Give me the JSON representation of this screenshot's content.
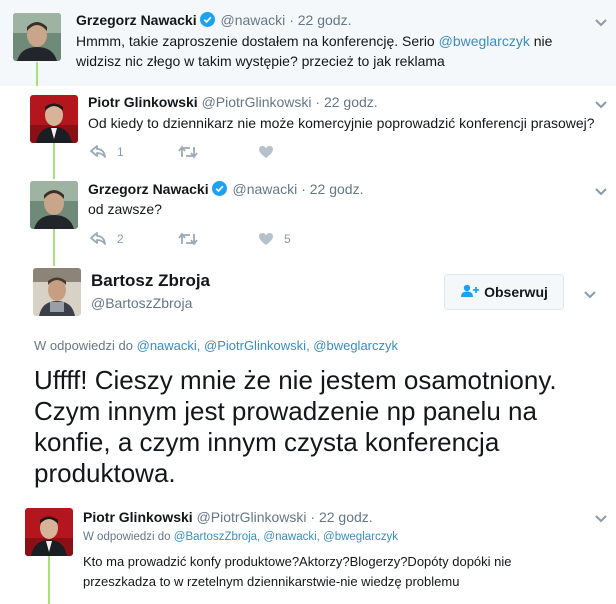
{
  "tweets": [
    {
      "name": "Grzegorz Nawacki",
      "handle": "@nawacki",
      "time": "22 godz.",
      "text_prefix": "Hmmm, takie zaproszenie dostałem na konferencję. Serio ",
      "text_mention": "@bweglarczyk",
      "text_suffix": " nie widzisz nic złego w takim występie? przecież to jak reklama"
    },
    {
      "name": "Piotr Glinkowski",
      "handle": "@PiotrGlinkowski",
      "time": "22 godz.",
      "text": "Od kiedy to dziennikarz nie może komercyjnie poprowadzić konferencji prasowej?",
      "replies": "1",
      "retweets": "",
      "likes": ""
    },
    {
      "name": "Grzegorz Nawacki",
      "handle": "@nawacki",
      "time": "22 godz.",
      "text": "od zawsze?",
      "replies": "2",
      "retweets": "",
      "likes": "5"
    }
  ],
  "focused": {
    "name": "Bartosz Zbroja",
    "handle": "@BartoszZbroja",
    "follow_label": "Obserwuj",
    "replying_prefix": "W odpowiedzi do",
    "replying_mentions": "@nawacki, @PiotrGlinkowski, @bweglarczyk",
    "text": "Uffff! Cieszy mnie że nie jestem osamotniony. Czym innym jest prowadzenie np panelu na konfie, a czym innym czysta konferencja produktowa."
  },
  "last_reply": {
    "name": "Piotr Glinkowski",
    "handle": "@PiotrGlinkowski",
    "time": "22 godz.",
    "replying_prefix": "W odpowiedzi do",
    "replying_mentions": "@BartoszZbroja, @nawacki, @bweglarczyk",
    "text": "Kto ma prowadzić konfy produktowe?Aktorzy?Blogerzy?Dopóty dopóki nie przeszkadza to w rzetelnym dziennikarstwie-nie wiedzę problemu"
  },
  "icons": [
    "verified-badge-icon",
    "chevron-down-icon",
    "reply-icon",
    "retweet-icon",
    "heart-icon",
    "add-user-icon"
  ],
  "colors": {
    "accent": "#3a8dc2",
    "thread_line": "#a8e07a",
    "verified": "#1da1f2",
    "muted": "#657786"
  }
}
